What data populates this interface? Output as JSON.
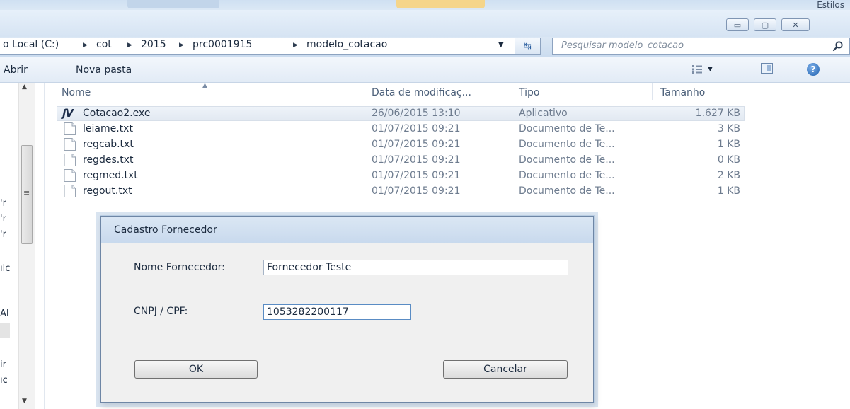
{
  "window": {
    "estilos_label": "Estilos",
    "controls": {
      "minimize": "▭",
      "maximize": "▢",
      "close": "✕"
    }
  },
  "address_bar": {
    "crumbs": [
      "o Local (C:)",
      "cot",
      "2015",
      "prc0001915",
      "modelo_cotacao"
    ],
    "search_placeholder": "Pesquisar modelo_cotacao"
  },
  "toolbar": {
    "open_label": "Abrir",
    "new_folder_label": "Nova pasta",
    "help_label": "?"
  },
  "columns": {
    "name": "Nome",
    "modified": "Data de modificaç...",
    "type": "Tipo",
    "size": "Tamanho"
  },
  "files": [
    {
      "name": "Cotacao2.exe",
      "modified": "26/06/2015 13:10",
      "type": "Aplicativo",
      "size": "1.627 KB",
      "icon": "exe-icon",
      "selected": true
    },
    {
      "name": "leiame.txt",
      "modified": "01/07/2015 09:21",
      "type": "Documento de Te...",
      "size": "3 KB",
      "icon": "text-file-icon"
    },
    {
      "name": "regcab.txt",
      "modified": "01/07/2015 09:21",
      "type": "Documento de Te...",
      "size": "1 KB",
      "icon": "text-file-icon"
    },
    {
      "name": "regdes.txt",
      "modified": "01/07/2015 09:21",
      "type": "Documento de Te...",
      "size": "0 KB",
      "icon": "text-file-icon"
    },
    {
      "name": "regmed.txt",
      "modified": "01/07/2015 09:21",
      "type": "Documento de Te...",
      "size": "2 KB",
      "icon": "text-file-icon"
    },
    {
      "name": "regout.txt",
      "modified": "01/07/2015 09:21",
      "type": "Documento de Te...",
      "size": "1 KB",
      "icon": "text-file-icon"
    }
  ],
  "nav_fragments": [
    "'r",
    "'r",
    "'r",
    "ılc",
    "AI",
    "ir",
    "ıc"
  ],
  "dialog": {
    "title": "Cadastro Fornecedor",
    "supplier_label": "Nome Fornecedor:",
    "supplier_value": "Fornecedor Teste",
    "document_label": "CNPJ / CPF:",
    "document_value": "1053282200117",
    "ok_label": "OK",
    "cancel_label": "Cancelar"
  },
  "colors": {
    "chrome": "#d6e4f3",
    "dialog_bg": "#f0f0f0",
    "text": "#1b2a3e",
    "meta_text": "#6e7c8f"
  }
}
